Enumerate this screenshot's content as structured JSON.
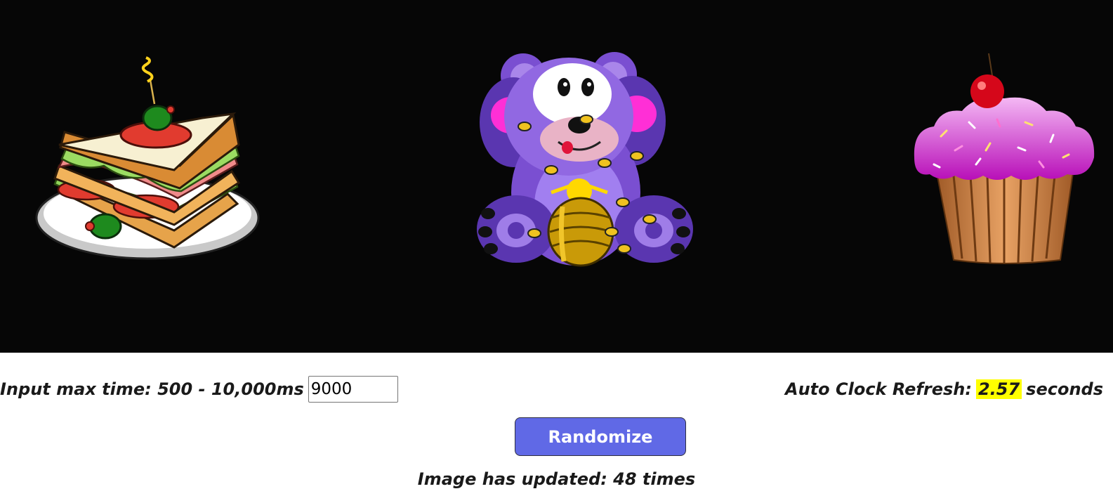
{
  "images": {
    "left_icon": "sandwich-icon",
    "center_icon": "teddy-bear-with-honey-pot-icon",
    "right_icon": "cupcake-icon",
    "background": "#060606"
  },
  "controls": {
    "max_time_label": "Input max time: 500 - 10,000ms",
    "max_time_value": "9000",
    "clock_label": "Auto Clock Refresh:",
    "clock_value": "2.57",
    "clock_unit": "seconds",
    "clock_highlight": "#ffff00"
  },
  "randomize": {
    "label": "Randomize",
    "color": "#6069e6"
  },
  "status": {
    "update_text": "Image has updated: 48 times"
  }
}
